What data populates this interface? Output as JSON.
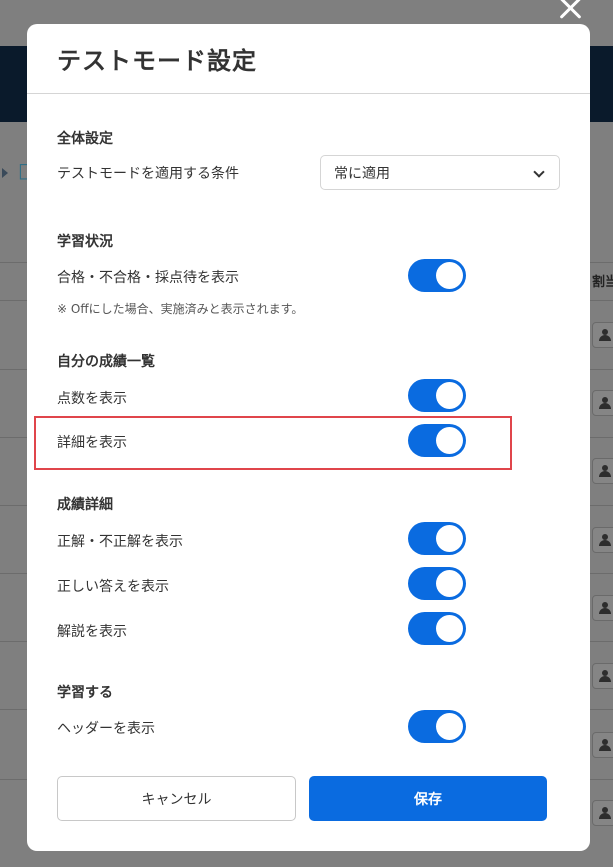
{
  "modal": {
    "title": "テストモード設定",
    "sections": {
      "general": {
        "title": "全体設定",
        "condition_label": "テストモードを適用する条件",
        "condition_value": "常に適用"
      },
      "learning_status": {
        "title": "学習状況",
        "pass_fail_label": "合格・不合格・採点待を表示",
        "pass_fail_on": true,
        "note": "※ Offにした場合、実施済みと表示されます。"
      },
      "my_results": {
        "title": "自分の成績一覧",
        "score_label": "点数を表示",
        "score_on": true,
        "detail_label": "詳細を表示",
        "detail_on": true
      },
      "result_detail": {
        "title": "成績詳細",
        "correct_label": "正解・不正解を表示",
        "correct_on": true,
        "answer_label": "正しい答えを表示",
        "answer_on": true,
        "explanation_label": "解説を表示",
        "explanation_on": true
      },
      "study": {
        "title": "学習する",
        "header_label": "ヘッダーを表示",
        "header_on": true
      }
    },
    "buttons": {
      "cancel": "キャンセル",
      "save": "保存"
    }
  },
  "background": {
    "title_fragment": "□",
    "column_header": "割当"
  },
  "colors": {
    "accent": "#0a6be0",
    "highlight_border": "#e0454b",
    "overlay": "#7f7f7f"
  }
}
